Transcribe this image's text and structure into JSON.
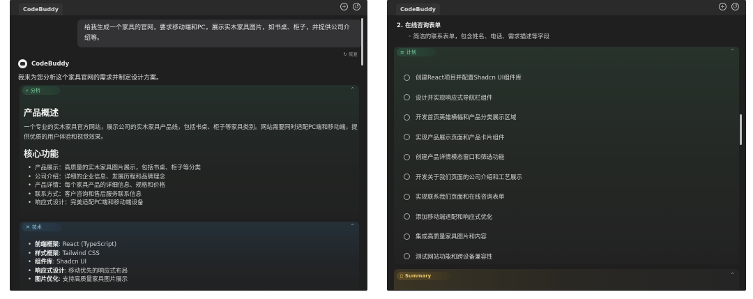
{
  "left": {
    "tab_title": "CodeBuddy",
    "user_message": "给我生成一个家具的官网，要求移动端和PC，展示实木家具图片，如书桌、柜子，并提供公司介绍等。",
    "retry_label": "↻ 恢复",
    "bot_name": "CodeBuddy",
    "intro": "我来为您分析这个家具官网的需求并制定设计方案。",
    "analysis": {
      "tag": "分析",
      "overview_heading": "产品概述",
      "overview_text": "一个专业的实木家具官方网站，展示公司的实木家具产品线，包括书桌、柜子等家具类别。网站需要同时适配PC端和移动端，提供优质的用户体验和视觉效果。",
      "core_heading": "核心功能",
      "features": [
        "产品展示：高质量的实木家具图片展示，包括书桌、柜子等分类",
        "公司介绍：详细的企业信息、发展历程和品牌理念",
        "产品详情：每个家具产品的详细信息、规格和价格",
        "联系方式：客户咨询和售后服务联系信息",
        "响应式设计：完美适配PC端和移动端设备"
      ]
    },
    "tech": {
      "tag": "技术",
      "items": [
        {
          "k": "前端框架",
          "v": ": React (TypeScript)"
        },
        {
          "k": "样式框架",
          "v": ": Tailwind CSS"
        },
        {
          "k": "组件库",
          "v": ": Shadcn UI"
        },
        {
          "k": "响应式设计",
          "v": ": 移动优先的响应式布局"
        },
        {
          "k": "图片优化",
          "v": ": 支持高质量家具图片展示"
        }
      ]
    }
  },
  "right": {
    "tab_title": "CodeBuddy",
    "ordered_item": "2. 在线咨询表单",
    "sub_item": "◦ 简洁的联系表单，包含姓名、电话、需求描述等字段",
    "plan": {
      "tag": "计划",
      "steps": [
        "创建React项目并配置Shadcn UI组件库",
        "设计并实现响应式导航栏组件",
        "开发首页英雄横幅和产品分类展示区域",
        "实现产品展示页面和产品卡片组件",
        "创建产品详情模态窗口和筛选功能",
        "开发关于我们页面的公司介绍和工艺展示",
        "实现联系我们页面和在线咨询表单",
        "添加移动端适配和响应式优化",
        "集成高质量家具图片和内容",
        "测试网站功能和跨设备兼容性"
      ]
    },
    "summary_tag": "Summary"
  }
}
